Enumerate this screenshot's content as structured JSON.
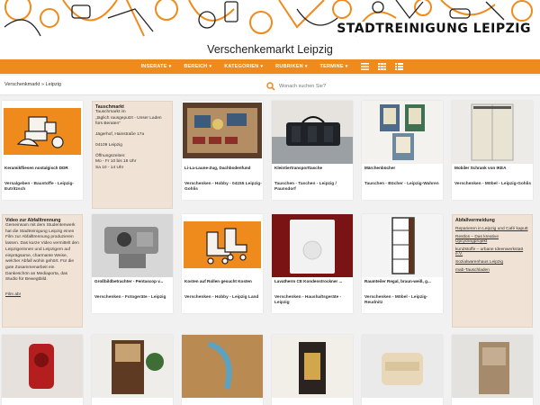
{
  "brand": "STADTREINIGUNG LEIPZIG",
  "site_title": "Verschenkemarkt Leipzig",
  "nav": {
    "items": [
      "INSERATE",
      "BEREICH",
      "KATEGORIEN",
      "RUBRIKEN",
      "TERMINE"
    ],
    "view_icons": [
      "list-view-icon",
      "grid-view-icon",
      "list-detail-icon"
    ]
  },
  "breadcrumb": "Verschenkmarkt » Leipzig",
  "search": {
    "placeholder": "Wonach suchen Sie?"
  },
  "tauschmarkt": {
    "title": "Tauschmarkt",
    "line1": "Tauschmarkt im",
    "line2": "„täglich rausgeputzt - Unser Laden",
    "line3": "fürs Beraten\"",
    "address": "Jägerhof, Hainstraße 17a",
    "city": "04109 Leipzig",
    "hours_label": "Öffnungszeiten:",
    "hours1": "Mo - Fr 10 bis 18 Uhr",
    "hours2": "Sa 10 - 14 Uhr"
  },
  "video": {
    "title": "Video zur Abfalltrennung",
    "text": "Gemeinsam mit dem Studentenwerk hat die Stadtreinigung Leipzig einen Film zur Abfalltrennung produzieren lassen. Das kurze Video vermittelt den Leipzigerinnen und Leipzigern auf einprägsame, charmante Weise, welcher Abfall wohin gehört. Für die gute Zusammenarbeit ein Dankeschön an Mediaporta, das Studio für Bewegtbild.",
    "link": "Film ab!"
  },
  "avoid": {
    "title": "Abfallvermeidung",
    "links": [
      "Reparieren in Leipzig und Café kaputt",
      "Restlos – Das kreative Upcyclingprojekt",
      "kunZstoffe – urbane Ideenwerkstatt e.V.",
      "Sozialwarenhaus Leipzig",
      "mab-Tauschladen"
    ]
  },
  "cards": [
    {
      "caption": "Keramikfliesen nostalgisch DDR",
      "meta": "Versalgeben - Baustoffe - Leipzig-Eutritzsch"
    },
    {
      "caption": "Li-La-Laune-Zug, Dachbodenfund",
      "meta": "Verschenken - Hobby - 04155 Leipzig-Gohlis"
    },
    {
      "caption": "Kleintiertransporttasche",
      "meta": "Tauschen - Taschen - Leipzig / Paunsdorf"
    },
    {
      "caption": "Märchenbücher",
      "meta": "Tauschen - Bücher - Leipzig-Wahren"
    },
    {
      "caption": "Mobiler Schrank von IKEA",
      "meta": "Verschenken - Möbel - Leipzig-Gohlis"
    },
    {
      "caption": "Großbildbetrachter - Pentascop v...",
      "meta": "Verschenken - Fotogeräte - Leipzig"
    },
    {
      "caption": "Kosten auf Rollen gesucht Kosten",
      "meta": "Verschenken - Hobby - Leipzig Land"
    },
    {
      "caption": "Lavatherm CE Kondenstrockner ...",
      "meta": "Verschenken - Haushaltsgeräte - Leipzig"
    },
    {
      "caption": "Raumteiler Regal, braun-weiß, g...",
      "meta": "Verschenken - Möbel - Leipzig-Reudnitz"
    }
  ],
  "colors": {
    "accent": "#ef8a1c",
    "sidebar": "#f0e2d4"
  }
}
